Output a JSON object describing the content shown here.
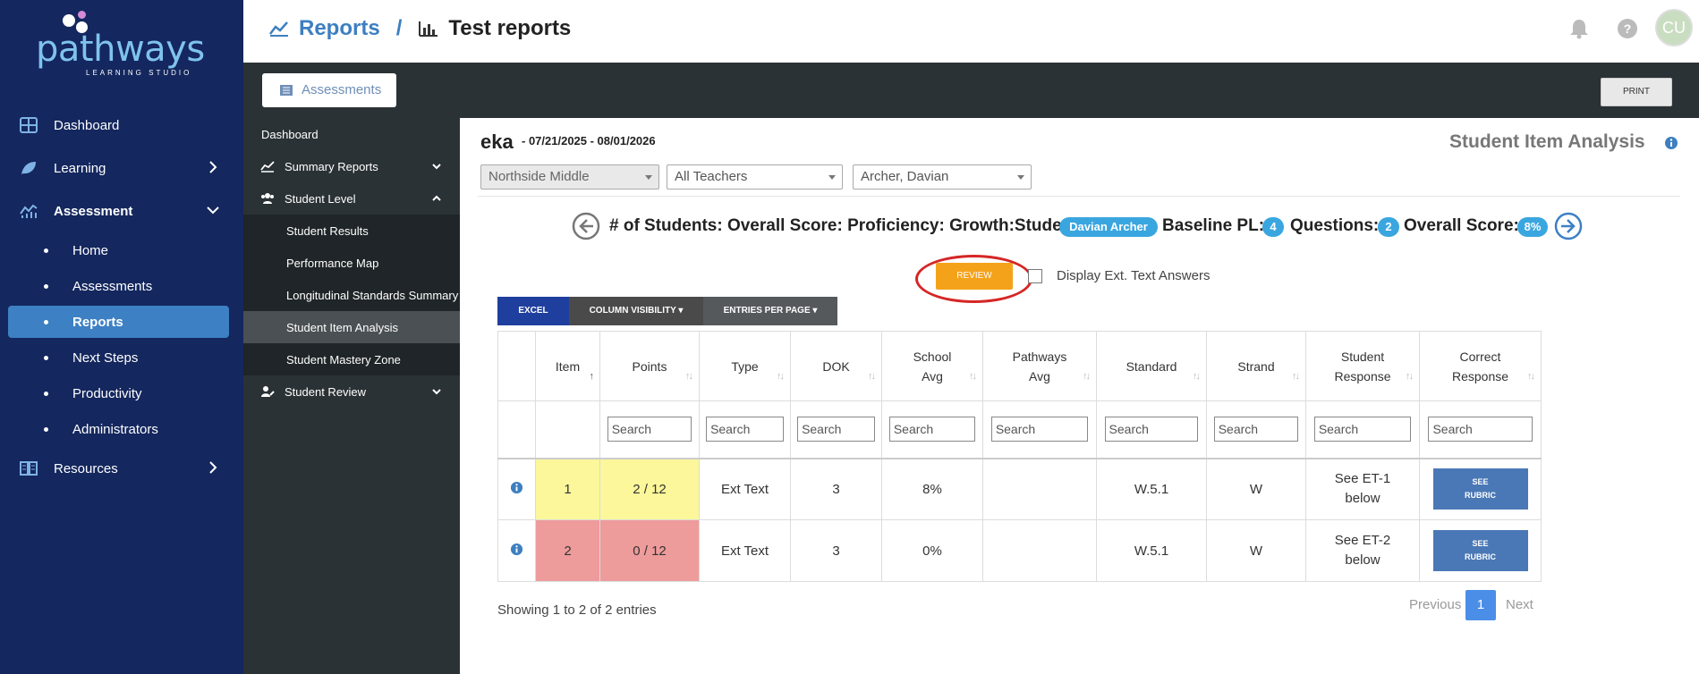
{
  "brand": {
    "name": "pathways",
    "tagline": "LEARNING STUDIO"
  },
  "sidebar": {
    "items": [
      {
        "label": "Dashboard",
        "icon": "grid-icon"
      },
      {
        "label": "Learning",
        "icon": "leaf-icon"
      },
      {
        "label": "Assessment",
        "icon": "analytics-icon"
      },
      {
        "label": "Resources",
        "icon": "book-icon"
      }
    ],
    "assessment_children": [
      "Home",
      "Assessments",
      "Reports",
      "Next Steps",
      "Productivity",
      "Administrators"
    ],
    "active_child": "Reports"
  },
  "header": {
    "crumb_reports": "Reports",
    "crumb_sep": "/",
    "crumb_page": "Test reports",
    "avatar_initials": "CU"
  },
  "toolbar": {
    "assessments_label": "Assessments",
    "print_label": "PRINT"
  },
  "subnav": {
    "dashboard": "Dashboard",
    "summary_reports": "Summary Reports",
    "student_level": "Student Level",
    "children": [
      "Student Results",
      "Performance Map",
      "Longitudinal Standards Summary",
      "Student Item Analysis",
      "Student Mastery Zone"
    ],
    "student_review": "Student Review"
  },
  "main": {
    "title": "eka",
    "dates": "- 07/21/2025 - 08/01/2026",
    "heading": "Student Item Analysis",
    "filters": {
      "school": "Northside Middle",
      "teacher": "All Teachers",
      "student": "Archer, Davian"
    },
    "summary": {
      "label_text": "# of Students: Overall Score: Proficiency: Growth:Student:",
      "student_name": "Davian Archer",
      "baseline_label": "Baseline PL:",
      "baseline_value": "4",
      "questions_label": "Questions:",
      "questions_value": "2",
      "overall_label": "Overall Score:",
      "overall_value": "8%"
    },
    "review_label": "REVIEW",
    "ext_text_label": "Display Ext. Text Answers",
    "table_buttons": {
      "excel": "EXCEL",
      "column_visibility": "COLUMN VISIBILITY ▾",
      "entries_per_page": "ENTRIES PER PAGE ▾"
    },
    "columns": [
      {
        "line1": "Item",
        "line2": ""
      },
      {
        "line1": "Points",
        "line2": ""
      },
      {
        "line1": "Type",
        "line2": ""
      },
      {
        "line1": "DOK",
        "line2": ""
      },
      {
        "line1": "School",
        "line2": "Avg"
      },
      {
        "line1": "Pathways",
        "line2": "Avg"
      },
      {
        "line1": "Standard",
        "line2": ""
      },
      {
        "line1": "Strand",
        "line2": ""
      },
      {
        "line1": "Student",
        "line2": "Response"
      },
      {
        "line1": "Correct",
        "line2": "Response"
      }
    ],
    "search_placeholder": "Search",
    "rows": [
      {
        "item": "1",
        "points": "2 / 12",
        "type": "Ext Text",
        "dok": "3",
        "school_avg": "8%",
        "pathways_avg": "",
        "standard": "W.5.1",
        "strand": "W",
        "response_l1": "See ET-1",
        "response_l2": "below",
        "rubric_l1": "SEE",
        "rubric_l2": "RUBRIC",
        "color": "#fbf79a"
      },
      {
        "item": "2",
        "points": "0 / 12",
        "type": "Ext Text",
        "dok": "3",
        "school_avg": "0%",
        "pathways_avg": "",
        "standard": "W.5.1",
        "strand": "W",
        "response_l1": "See ET-2",
        "response_l2": "below",
        "rubric_l1": "SEE",
        "rubric_l2": "RUBRIC",
        "color": "#ee9b9b"
      }
    ],
    "showing": "Showing 1 to 2 of 2 entries",
    "pagination": {
      "previous": "Previous",
      "page": "1",
      "next": "Next"
    }
  },
  "colors": {
    "sidebar_bg": "#14275e",
    "accent_blue": "#3d80c4",
    "dark_panel": "#2b3236",
    "pill_blue": "#3aa6e0",
    "review_orange": "#f5a21b"
  }
}
